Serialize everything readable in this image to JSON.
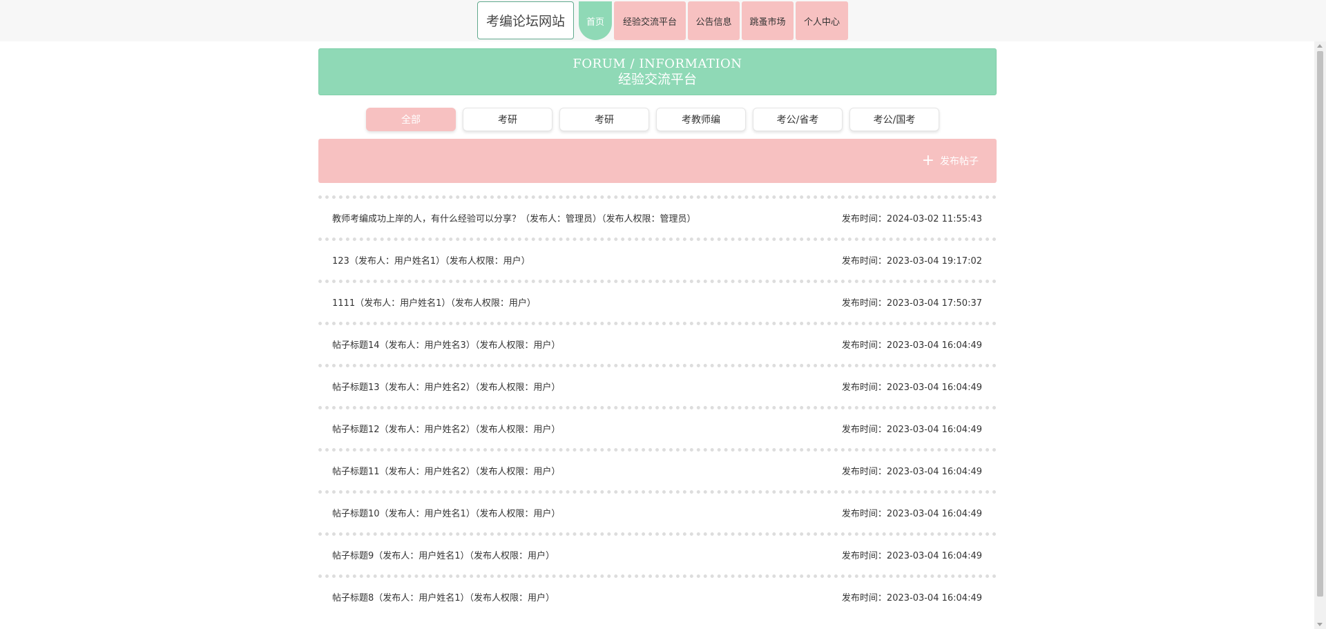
{
  "nav": {
    "brand": "考编论坛网站",
    "items": [
      {
        "label": "首页",
        "active": true
      },
      {
        "label": "经验交流平台",
        "active": false
      },
      {
        "label": "公告信息",
        "active": false
      },
      {
        "label": "跳蚤市场",
        "active": false
      },
      {
        "label": "个人中心",
        "active": false
      }
    ]
  },
  "banner": {
    "en": "FORUM / INFORMATION",
    "cn": "经验交流平台"
  },
  "categories": [
    "全部",
    "考研",
    "考研",
    "考教师编",
    "考公/省考",
    "考公/国考"
  ],
  "actions": {
    "publish_label": "发布帖子",
    "plus_icon": "+"
  },
  "posts": [
    {
      "title": "教师考编成功上岸的人，有什么经验可以分享？（发布人：管理员）（发布人权限：管理员）",
      "time": "发布时间：2024-03-02 11:55:43"
    },
    {
      "title": "123（发布人：用户姓名1）（发布人权限：用户）",
      "time": "发布时间：2023-03-04 19:17:02"
    },
    {
      "title": "1111（发布人：用户姓名1）（发布人权限：用户）",
      "time": "发布时间：2023-03-04 17:50:37"
    },
    {
      "title": "帖子标题14（发布人：用户姓名3）（发布人权限：用户）",
      "time": "发布时间：2023-03-04 16:04:49"
    },
    {
      "title": "帖子标题13（发布人：用户姓名2）（发布人权限：用户）",
      "time": "发布时间：2023-03-04 16:04:49"
    },
    {
      "title": "帖子标题12（发布人：用户姓名2）（发布人权限：用户）",
      "time": "发布时间：2023-03-04 16:04:49"
    },
    {
      "title": "帖子标题11（发布人：用户姓名2）（发布人权限：用户）",
      "time": "发布时间：2023-03-04 16:04:49"
    },
    {
      "title": "帖子标题10（发布人：用户姓名1）（发布人权限：用户）",
      "time": "发布时间：2023-03-04 16:04:49"
    },
    {
      "title": "帖子标题9（发布人：用户姓名1）（发布人权限：用户）",
      "time": "发布时间：2023-03-04 16:04:49"
    },
    {
      "title": "帖子标题8（发布人：用户姓名1）（发布人权限：用户）",
      "time": "发布时间：2023-03-04 16:04:49"
    }
  ]
}
